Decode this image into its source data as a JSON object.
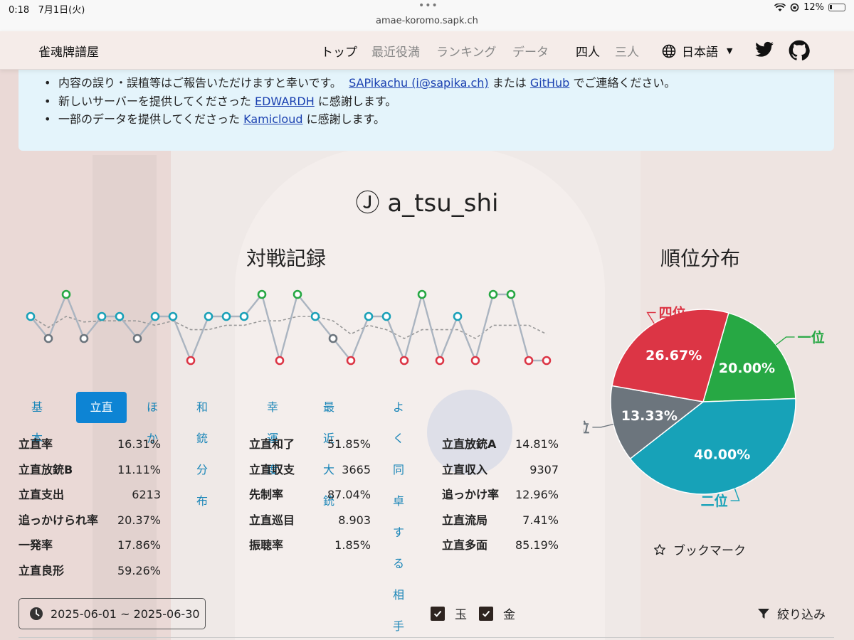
{
  "statusbar": {
    "time": "0:18",
    "date": "7月1日(火)",
    "url": "amae-koromo.sapk.ch",
    "battery": "12%"
  },
  "nav": {
    "brand": "雀魂牌譜屋",
    "items": [
      "トップ",
      "最近役満",
      "ランキング",
      "データ"
    ],
    "modes": [
      "四人",
      "三人"
    ],
    "language": "日本語"
  },
  "notice": {
    "line1": {
      "pre": "内容の誤り・誤植等はご報告いただけますと幸いです。",
      "link1": "SAPikachu (i@sapika.ch)",
      "mid": "または",
      "link2": "GitHub",
      "post": "でご連絡ください。"
    },
    "line2": {
      "pre": "新しいサーバーを提供してくださった",
      "link": "EDWARDH",
      "post": "に感謝します。"
    },
    "line3": {
      "pre": "一部のデータを提供してくださった",
      "link": "Kamicloud",
      "post": "に感謝します。"
    }
  },
  "player": {
    "rank_symbol": "Ⓙ",
    "name": "a_tsu_shi"
  },
  "titles": {
    "record": "対戦記録",
    "distribution": "順位分布"
  },
  "chart_data": [
    {
      "type": "line",
      "title": "対戦記録",
      "x": [
        1,
        2,
        3,
        4,
        5,
        6,
        7,
        8,
        9,
        10,
        11,
        12,
        13,
        14,
        15,
        16,
        17,
        18,
        19,
        20,
        21,
        22,
        23,
        24,
        25,
        26,
        27,
        28,
        29,
        30
      ],
      "series": [
        {
          "values": [
            2,
            3,
            1,
            3,
            2,
            2,
            3,
            2,
            2,
            4,
            2,
            2,
            2,
            1,
            4,
            1,
            2,
            3,
            4,
            2,
            2,
            4,
            1,
            4,
            2,
            4,
            1,
            1,
            4,
            4
          ]
        }
      ],
      "ylim": [
        1,
        4
      ],
      "colors": {
        "1": "#27a844",
        "2": "#1ba1b8",
        "3": "#6c757d",
        "4": "#dc3545",
        "line": "#aab4c0",
        "avg": "#999999"
      }
    },
    {
      "type": "pie",
      "title": "順位分布",
      "labels": [
        "一位",
        "二位",
        "三位",
        "四位"
      ],
      "values": [
        20.0,
        40.0,
        13.33,
        26.67
      ],
      "value_labels": [
        "20.00%",
        "40.00%",
        "13.33%",
        "26.67%"
      ],
      "colors": [
        "#27a844",
        "#17a2b8",
        "#6c757d",
        "#dc3545"
      ]
    }
  ],
  "tabs": [
    "基本",
    "立直",
    "ほか",
    "和銃分布",
    "幸運度",
    "最近大銃",
    "よく同卓する相手"
  ],
  "stats": [
    {
      "k": "立直率",
      "v": "16.31%"
    },
    {
      "k": "立直和了",
      "v": "51.85%"
    },
    {
      "k": "立直放銃A",
      "v": "14.81%"
    },
    {
      "k": "立直放銃B",
      "v": "11.11%"
    },
    {
      "k": "立直収支",
      "v": "3665"
    },
    {
      "k": "立直収入",
      "v": "9307"
    },
    {
      "k": "立直支出",
      "v": "6213"
    },
    {
      "k": "先制率",
      "v": "87.04%"
    },
    {
      "k": "追っかけ率",
      "v": "12.96%"
    },
    {
      "k": "追っかけられ率",
      "v": "20.37%"
    },
    {
      "k": "立直巡目",
      "v": "8.903"
    },
    {
      "k": "立直流局",
      "v": "7.41%"
    },
    {
      "k": "一発率",
      "v": "17.86%"
    },
    {
      "k": "振聴率",
      "v": "1.85%"
    },
    {
      "k": "立直多面",
      "v": "85.19%"
    },
    {
      "k": "立直良形",
      "v": "59.26%"
    }
  ],
  "bookmark": "ブックマーク",
  "daterange": "2025-06-01 ~ 2025-06-30",
  "filters": {
    "gyoku": "玉",
    "kin": "金",
    "narrow": "絞り込み"
  },
  "icons": {
    "clock": "clock-icon",
    "globe": "globe-icon",
    "twitter": "twitter-icon",
    "github": "github-icon",
    "star": "star-icon",
    "filter": "filter-icon"
  }
}
